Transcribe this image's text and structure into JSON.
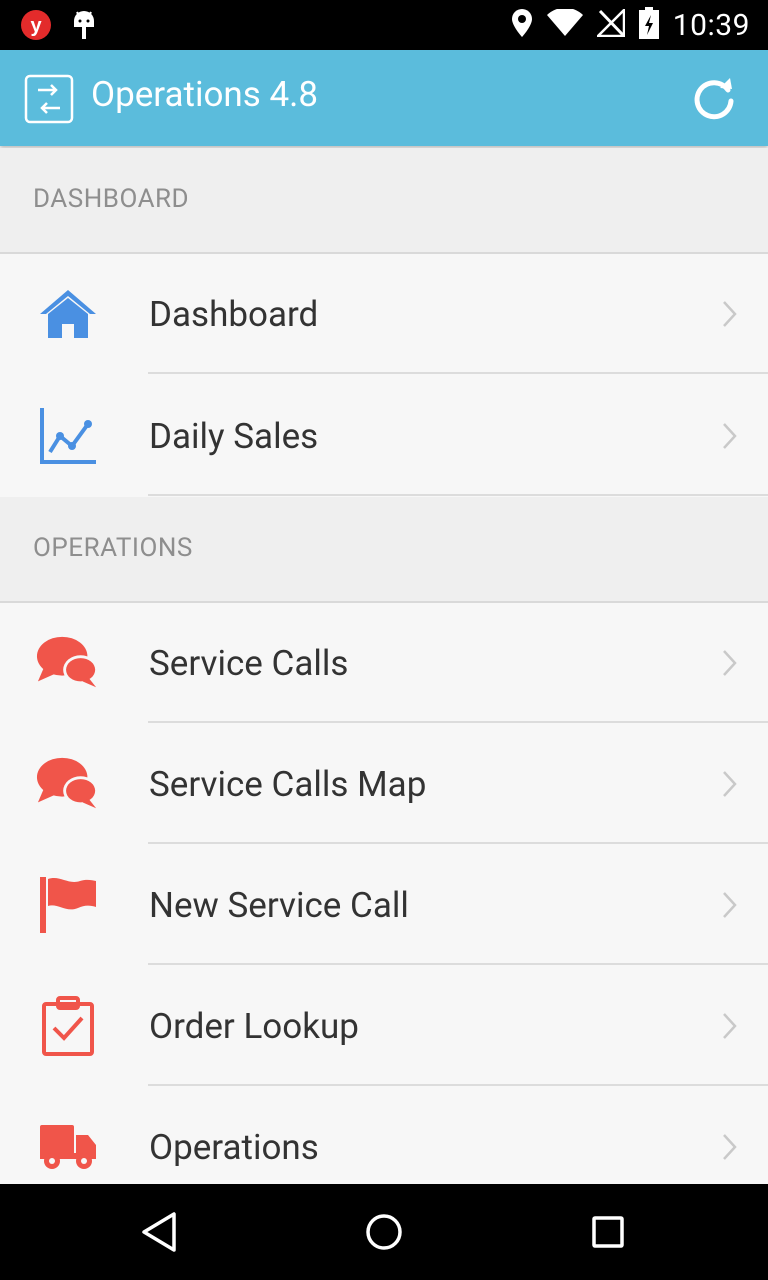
{
  "status_bar": {
    "time": "10:39"
  },
  "app_bar": {
    "title": "Operations 4.8"
  },
  "sections": {
    "dashboard": {
      "header": "DASHBOARD",
      "items": [
        {
          "label": "Dashboard",
          "icon": "home-icon"
        },
        {
          "label": "Daily Sales",
          "icon": "line-chart-icon"
        }
      ]
    },
    "operations": {
      "header": "OPERATIONS",
      "items": [
        {
          "label": "Service Calls",
          "icon": "chat-bubbles-icon"
        },
        {
          "label": "Service Calls Map",
          "icon": "chat-bubbles-icon"
        },
        {
          "label": "New Service Call",
          "icon": "flag-icon"
        },
        {
          "label": "Order Lookup",
          "icon": "clipboard-check-icon"
        },
        {
          "label": "Operations",
          "icon": "truck-icon"
        }
      ]
    }
  },
  "colors": {
    "accent": "#5bbcdc",
    "dashboard_icon": "#4a90e2",
    "operations_icon": "#f0554a"
  }
}
